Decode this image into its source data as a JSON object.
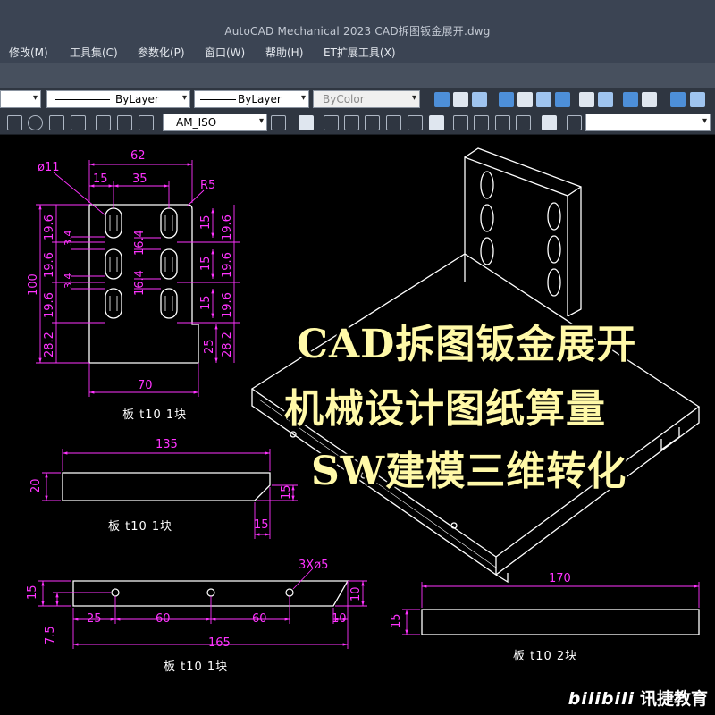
{
  "window": {
    "title": "AutoCAD Mechanical 2023    CAD拆图钣金展开.dwg"
  },
  "menu": [
    "修改(M)",
    "工具集(C)",
    "参数化(P)",
    "窗口(W)",
    "帮助(H)",
    "ET扩展工具(X)"
  ],
  "toolbar": {
    "linetype": "ByLayer",
    "lineweight": "ByLayer",
    "color": "ByColor",
    "dimstyle": "AM_ISO"
  },
  "drawing": {
    "dims_top": [
      "62",
      "15",
      "35",
      "R5",
      "ø11",
      "19.6",
      "19.6",
      "19.6",
      "28.2",
      "100",
      "3.4",
      "3.4",
      "16.4",
      "16.4",
      "15",
      "15",
      "15",
      "19.6",
      "19.6",
      "19.6",
      "28.2",
      "25",
      "70"
    ],
    "dims_mid": [
      "135",
      "20",
      "15",
      "15"
    ],
    "dims_bottom": [
      "3Xø5",
      "15",
      "7.5",
      "25",
      "60",
      "60",
      "10",
      "10",
      "165"
    ],
    "dims_right": [
      "170",
      "15"
    ],
    "captions": [
      "板 t10 1块",
      "板 t10 1块",
      "板 t10 1块",
      "板 t10 2块"
    ]
  },
  "promo": {
    "lines": [
      "CAD拆图钣金展开",
      "机械设计图纸算量",
      "SW建模三维转化"
    ]
  },
  "brand": {
    "logo": "bilibili",
    "name": "讯捷教育"
  },
  "colors": {
    "dim": "#ff33ff",
    "geometry": "#ffffff",
    "overlay": "#fff9a8"
  }
}
